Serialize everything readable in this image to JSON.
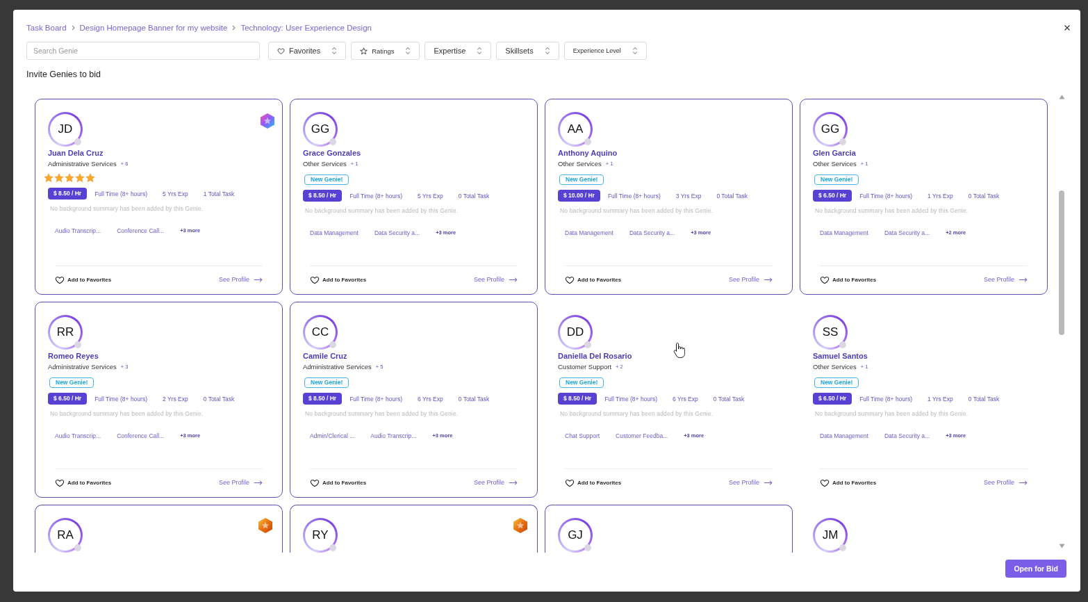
{
  "breadcrumb": [
    "Task Board",
    "Design Homepage Banner for my website",
    "Technology: User Experience Design"
  ],
  "search": {
    "placeholder": "Search Genie"
  },
  "filters": [
    {
      "label": "Favorites",
      "kind": "favorites"
    },
    {
      "label": "Ratings",
      "kind": "ratings"
    },
    {
      "label": "Expertise",
      "kind": "select"
    },
    {
      "label": "Skillsets",
      "kind": "select"
    },
    {
      "label": "Experience Level",
      "kind": "select"
    }
  ],
  "section_title": "Invite Genies to bid",
  "cards": [
    {
      "initials": "JD",
      "name": "Juan Dela Cruz",
      "category": "Administrative Services",
      "category_more": "+ 6",
      "stars": 5,
      "rate": "$ 8.50 / Hr",
      "schedule": "Full Time (8+ hours)",
      "experience": "5 Yrs Exp",
      "tasks": "1 Total Task",
      "summary": "No background summary has been added by this Genie.",
      "skills": [
        "Audio Transcrip...",
        "Conference Call..."
      ],
      "more": "+3 more",
      "favorite": false,
      "favorite_label": "Add to Favorites",
      "profile_label": "See Profile",
      "outlined": true,
      "badge": {
        "kind": "multicolor"
      }
    },
    {
      "initials": "GG",
      "name": "Grace Gonzales",
      "category": "Other Services",
      "category_more": "+ 1",
      "tag": "New Genie!",
      "rate": "$ 8.50 / Hr",
      "schedule": "Full Time (8+ hours)",
      "experience": "5 Yrs Exp",
      "tasks": "0 Total Task",
      "summary": "No background summary has been added by this Genie.",
      "skills": [
        "Data Management",
        "Data Security a..."
      ],
      "more": "+3 more",
      "favorite": false,
      "favorite_label": "Add to Favorites",
      "profile_label": "See Profile",
      "outlined": true
    },
    {
      "initials": "AA",
      "name": "Anthony Aquino",
      "category": "Other Services",
      "category_more": "+ 1",
      "tag": "New Genie!",
      "rate": "$ 10.00 / Hr",
      "schedule": "Full Time (8+ hours)",
      "experience": "3 Yrs Exp",
      "tasks": "0 Total Task",
      "summary": "No background summary has been added by this Genie.",
      "skills": [
        "Data Management",
        "Data Security a..."
      ],
      "more": "+3 more",
      "favorite": false,
      "favorite_label": "Add to Favorites",
      "profile_label": "See Profile",
      "outlined": true
    },
    {
      "initials": "GG",
      "name": "Glen Garcia",
      "category": "Other Services",
      "category_more": "+ 1",
      "tag": "New Genie!",
      "rate": "$ 6.50 / Hr",
      "schedule": "Full Time (8+ hours)",
      "experience": "1 Yrs Exp",
      "tasks": "0 Total Task",
      "summary": "No background summary has been added by this Genie.",
      "skills": [
        "Data Management",
        "Data Security a..."
      ],
      "more": "+2 more",
      "favorite": false,
      "favorite_label": "Add to Favorites",
      "profile_label": "See Profile",
      "outlined": true
    },
    {
      "initials": "RR",
      "name": "Romeo Reyes",
      "category": "Administrative Services",
      "category_more": "+ 3",
      "tag": "New Genie!",
      "rate": "$ 6.50 / Hr",
      "schedule": "Full Time (8+ hours)",
      "experience": "2 Yrs Exp",
      "tasks": "0 Total Task",
      "summary": "No background summary has been added by this Genie.",
      "skills": [
        "Audio Transcrip...",
        "Conference Call..."
      ],
      "more": "+3 more",
      "favorite": false,
      "favorite_label": "Add to Favorites",
      "profile_label": "See Profile",
      "outlined": true
    },
    {
      "initials": "CC",
      "name": "Camile Cruz",
      "category": "Administrative Services",
      "category_more": "+ 5",
      "tag": "New Genie!",
      "rate": "$ 8.50 / Hr",
      "schedule": "Full Time (8+ hours)",
      "experience": "6 Yrs Exp",
      "tasks": "0 Total Task",
      "summary": "No background summary has been added by this Genie.",
      "skills": [
        "Admin/Clerical ...",
        "Audio Transcrip..."
      ],
      "more": "+3 more",
      "favorite": false,
      "favorite_label": "Add to Favorites",
      "profile_label": "See Profile",
      "outlined": true
    },
    {
      "initials": "DD",
      "name": "Daniella Del Rosario",
      "category": "Customer Support",
      "category_more": "+ 2",
      "tag": "New Genie!",
      "rate": "$ 8.50 / Hr",
      "schedule": "Full Time (8+ hours)",
      "experience": "6 Yrs Exp",
      "tasks": "0 Total Task",
      "summary": "No background summary has been added by this Genie.",
      "skills": [
        "Chat Support",
        "Customer Feedba..."
      ],
      "more": "+3 more",
      "favorite": false,
      "favorite_label": "Add to Favorites",
      "profile_label": "See Profile",
      "outlined": false
    },
    {
      "initials": "SS",
      "name": "Samuel Santos",
      "category": "Other Services",
      "category_more": "+ 1",
      "tag": "New Genie!",
      "rate": "$ 6.50 / Hr",
      "schedule": "Full Time (8+ hours)",
      "experience": "1 Yrs Exp",
      "tasks": "0 Total Task",
      "summary": "No background summary has been added by this Genie.",
      "skills": [
        "Data Management",
        "Data Security a..."
      ],
      "more": "+3 more",
      "favorite": false,
      "favorite_label": "Add to Favorites",
      "profile_label": "See Profile",
      "outlined": false
    },
    {
      "initials": "RA",
      "outlined": true,
      "badge": {
        "kind": "orange"
      }
    },
    {
      "initials": "RY",
      "outlined": true,
      "badge": {
        "kind": "orange"
      }
    },
    {
      "initials": "GJ",
      "outlined": true
    },
    {
      "initials": "JM",
      "outlined": false
    }
  ],
  "footer": {
    "button": "Open for Bid"
  }
}
